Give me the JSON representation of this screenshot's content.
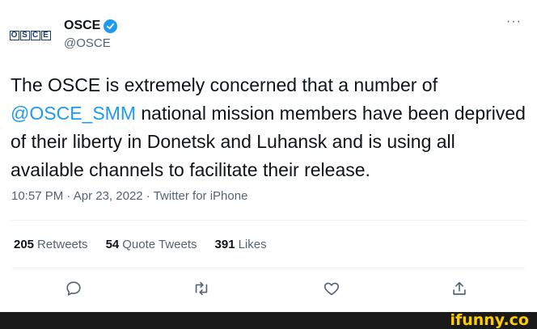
{
  "author": {
    "display_name": "OSCE",
    "handle": "@OSCE",
    "verified": true,
    "logo_letters": [
      "O",
      "S",
      "C",
      "E"
    ]
  },
  "more_label": "···",
  "tweet": {
    "text_before": "The OSCE is extremely concerned that a number of ",
    "mention": "@OSCE_SMM",
    "text_after": " national mission members have been deprived of their liberty in Donetsk and Luhansk and is using all available channels to facilitate their release."
  },
  "meta": {
    "time": "10:57 PM",
    "date": "Apr 23, 2022",
    "source": "Twitter for iPhone",
    "separator": " · "
  },
  "stats": [
    {
      "count": "205",
      "label": "Retweets"
    },
    {
      "count": "54",
      "label": "Quote Tweets"
    },
    {
      "count": "391",
      "label": "Likes"
    }
  ],
  "watermark": "ifunny.co",
  "colors": {
    "accent": "#1d9bf0",
    "text": "#0f1419",
    "secondary": "#536471",
    "footer": "#1a1a1a",
    "watermark": "#ffcc00"
  }
}
